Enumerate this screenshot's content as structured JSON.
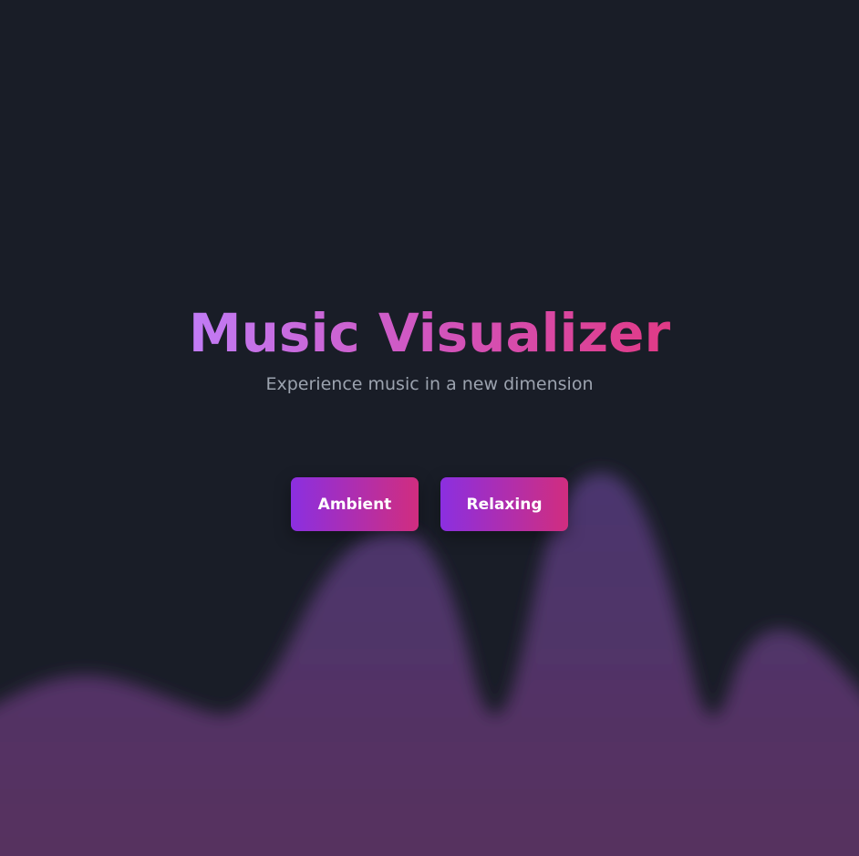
{
  "hero": {
    "title": "Music Visualizer",
    "subtitle": "Experience music in a new dimension"
  },
  "buttons": [
    {
      "label": "Ambient"
    },
    {
      "label": "Relaxing"
    }
  ],
  "colors": {
    "background": "#191d27",
    "title_gradient_start": "#c17cf6",
    "title_gradient_end": "#e13a86",
    "button_gradient_start": "#8b2fe0",
    "button_gradient_end": "#d12d7f",
    "subtitle": "#9ca3af",
    "wave_top": "#4c3670",
    "wave_bottom": "#57305e"
  }
}
